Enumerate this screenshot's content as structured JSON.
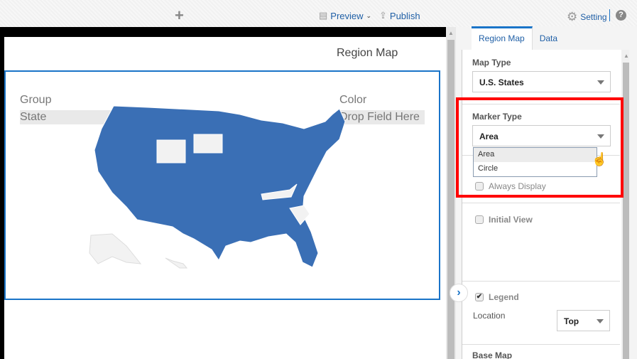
{
  "toolbar": {
    "add_icon": "plus-icon",
    "preview": "Preview",
    "publish": "Publish",
    "setting": "Setting",
    "help_icon": "question-circle-icon"
  },
  "canvas": {
    "title": "Region Map",
    "group_label": "Group",
    "group_value": "State",
    "color_label": "Color",
    "color_placeholder": "Drop Field Here",
    "map_color": "#3a6fb5"
  },
  "panel": {
    "tabs": [
      {
        "label": "Region Map",
        "active": true
      },
      {
        "label": "Data",
        "active": false
      }
    ],
    "map_type_label": "Map Type",
    "map_type_value": "U.S. States",
    "marker_type_label": "Marker Type",
    "marker_type_value": "Area",
    "marker_options": [
      "Area",
      "Circle"
    ],
    "always_display": "Always Display",
    "always_display_checked": false,
    "initial_view": "Initial View",
    "initial_view_checked": false,
    "legend": "Legend",
    "legend_checked": true,
    "location_label": "Location",
    "location_value": "Top",
    "base_map": "Base Map"
  },
  "highlight_color": "#ff0000"
}
